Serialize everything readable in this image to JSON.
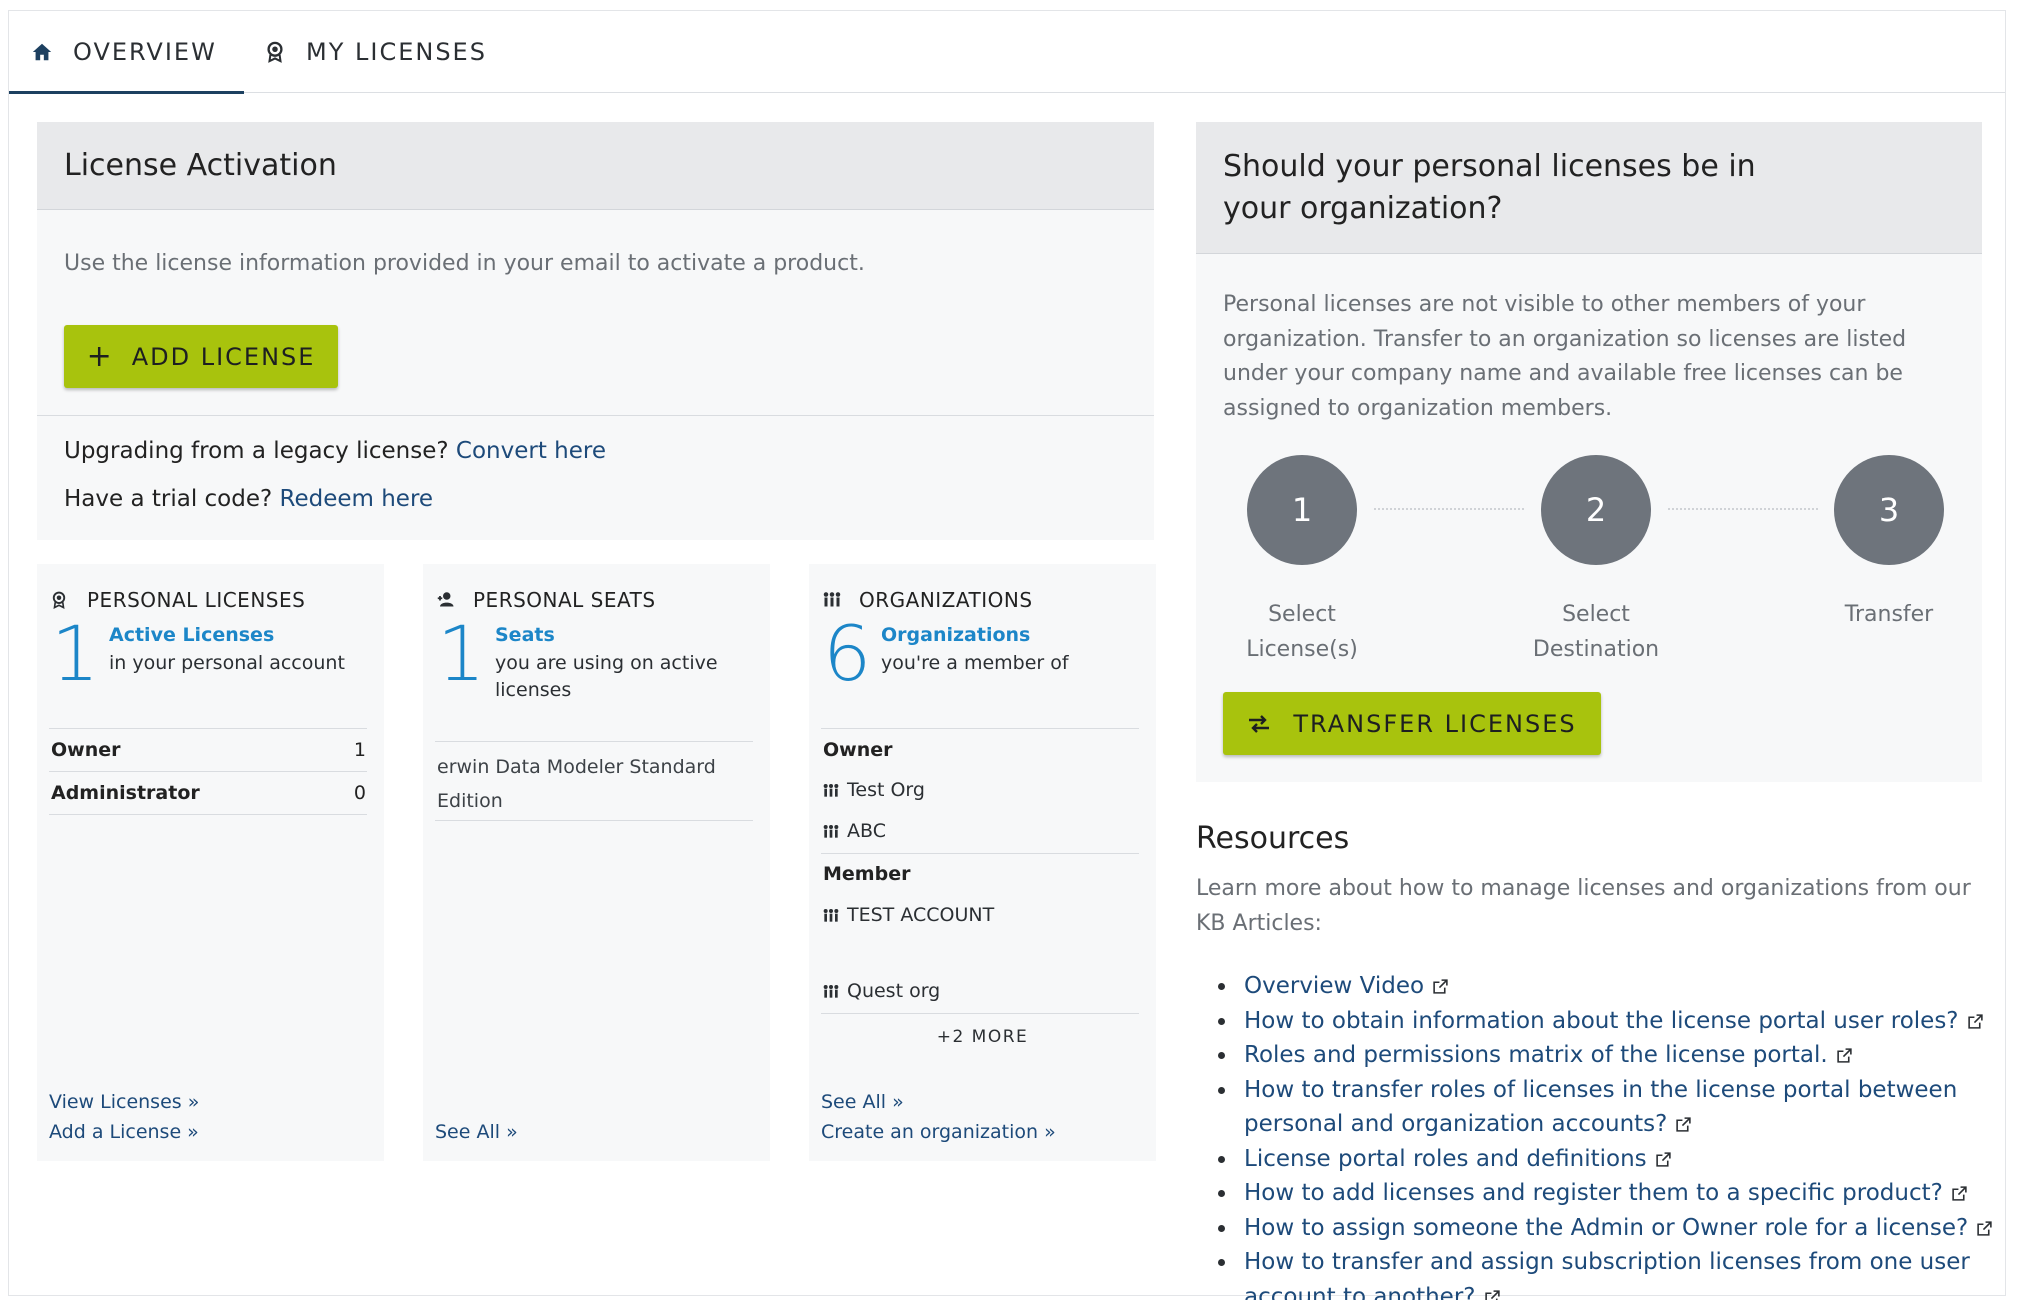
{
  "tabs": [
    {
      "label": "OVERVIEW",
      "icon": "home-icon",
      "active": true
    },
    {
      "label": "MY LICENSES",
      "icon": "award-icon",
      "active": false
    }
  ],
  "activation": {
    "title": "License Activation",
    "description": "Use the license information provided in your email to activate a product.",
    "add_button": "ADD LICENSE",
    "legacy_text": "Upgrading from a legacy license?",
    "legacy_link": "Convert here",
    "trial_text": "Have a trial code?",
    "trial_link": "Redeem here"
  },
  "personal_licenses": {
    "title": "PERSONAL LICENSES",
    "count": "1",
    "count_label": "Active Licenses",
    "count_sub": "in your personal account",
    "rows": [
      {
        "label": "Owner",
        "value": "1"
      },
      {
        "label": "Administrator",
        "value": "0"
      }
    ],
    "link_view": "View Licenses »",
    "link_add": "Add a License »"
  },
  "personal_seats": {
    "title": "PERSONAL SEATS",
    "count": "1",
    "count_label": "Seats",
    "count_sub": "you are using on active licenses",
    "item": "erwin Data Modeler Standard Edition",
    "link_see_all": "See All »"
  },
  "organizations": {
    "title": "ORGANIZATIONS",
    "count": "6",
    "count_label": "Organizations",
    "count_sub": "you're a member of",
    "owner_label": "Owner",
    "owner_orgs": [
      "Test Org",
      "ABC"
    ],
    "member_label": "Member",
    "member_orgs": [
      "TEST ACCOUNT",
      "Quest org"
    ],
    "more": "+2 MORE",
    "link_see_all": "See All »",
    "link_create": "Create an organization »"
  },
  "transfer": {
    "title": "Should your personal licenses be in your organization?",
    "description": "Personal licenses are not visible to other members of your organization. Transfer to an organization so licenses are listed under your company name and available free licenses can be assigned to organization members.",
    "steps": [
      {
        "num": "1",
        "label": "Select License(s)"
      },
      {
        "num": "2",
        "label": "Select Destination"
      },
      {
        "num": "3",
        "label": "Transfer"
      }
    ],
    "button": "TRANSFER LICENSES"
  },
  "resources": {
    "title": "Resources",
    "description": "Learn more about how to manage licenses and organizations from our KB Articles:",
    "links": [
      "Overview Video",
      "How to obtain information about the license portal user roles?",
      "Roles and permissions matrix of the license portal.",
      "How to transfer roles of licenses in the license portal between personal and organization accounts?",
      "License portal roles and definitions",
      "How to add licenses and register them to a specific product?",
      "How to assign someone the Admin or Owner role for a license?",
      "How to transfer and assign subscription licenses from one user account to another?"
    ]
  },
  "colors": {
    "accent_green": "#a8c30d",
    "link_blue": "#1d4a7a",
    "number_blue": "#1c86c8",
    "tab_underline": "#1d4060"
  }
}
